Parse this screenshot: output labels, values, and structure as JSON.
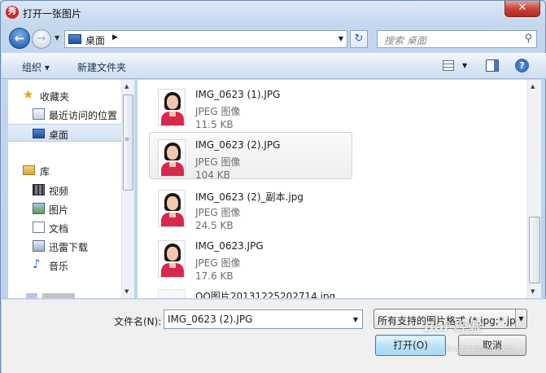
{
  "window": {
    "title": "打开一张图片",
    "app_icon_glyph": "秀",
    "close_glyph": "✕"
  },
  "address_bar": {
    "location": "桌面",
    "crumb_arrow": "▶",
    "dropdown_glyph": "▼",
    "refresh_glyph": "↻",
    "search_placeholder": "搜索 桌面",
    "search_glyph": "⚲"
  },
  "nav_buttons": {
    "back_glyph": "←",
    "forward_glyph": "→",
    "history_glyph": "▼"
  },
  "toolbar": {
    "organize_label": "组织 ▾",
    "new_folder_label": "新建文件夹",
    "view_drop_glyph": "▼",
    "help_glyph": "?"
  },
  "nav_pane": {
    "favorites": {
      "label": "收藏夹",
      "icon": "★"
    },
    "recent": {
      "label": "最近访问的位置"
    },
    "desktop": {
      "label": "桌面"
    },
    "libraries": {
      "label": "库"
    },
    "library_items": [
      {
        "label": "视频"
      },
      {
        "label": "图片"
      },
      {
        "label": "文档"
      },
      {
        "label": "迅雷下载"
      },
      {
        "label": "音乐",
        "icon": "♪"
      }
    ],
    "scroll_up": "▲",
    "scroll_down": "▼",
    "grip": "≡"
  },
  "files": [
    {
      "name": "IMG_0623 (1).JPG",
      "type": "JPEG 图像",
      "size": "11.5 KB"
    },
    {
      "name": "IMG_0623 (2).JPG",
      "type": "JPEG 图像",
      "size": "104 KB"
    },
    {
      "name": "IMG_0623 (2)_副本.jpg",
      "type": "JPEG 图像",
      "size": "24.5 KB"
    },
    {
      "name": "IMG_0623.JPG",
      "type": "JPEG 图像",
      "size": "17.6 KB"
    },
    {
      "name": "QQ图片20131225202714.jpg"
    }
  ],
  "footer": {
    "filename_label": "文件名(N):",
    "filename_value": "IMG_0623 (2).JPG",
    "filetype_value": "所有支持的图片格式 (*.jpg;*.jp",
    "dropdown_glyph": "▼",
    "open_label": "打开(O)",
    "cancel_label": "取消"
  },
  "watermark": {
    "brand": "Bai 经验",
    "sub": "jingyan.baidu.com"
  }
}
